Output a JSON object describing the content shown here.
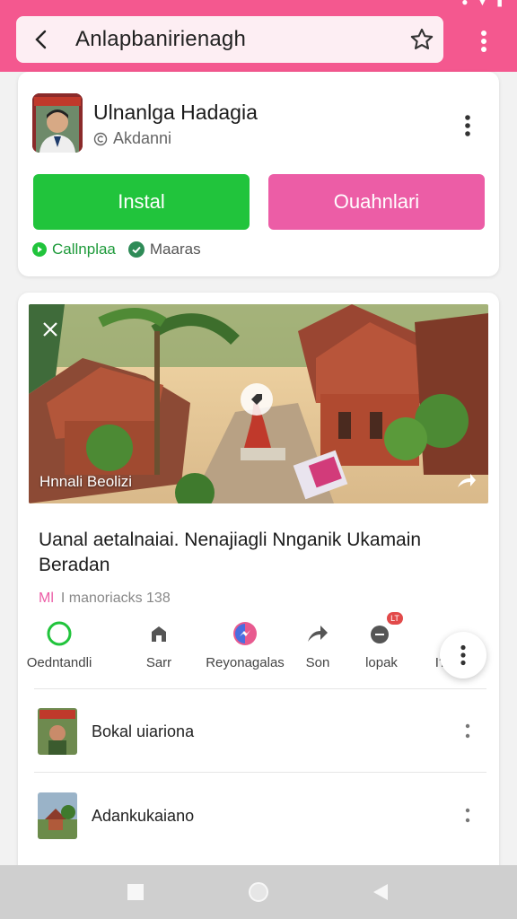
{
  "app_bar": {
    "title": "Anlapbanirienagh",
    "bg_color": "#f4588f"
  },
  "app_card": {
    "name": "Ulnanlga Hadagia",
    "developer": "Akdanni",
    "install_label": "Instal",
    "secondary_label": "Ouahnlari",
    "tags": [
      "Callnplaa",
      "Maaras"
    ],
    "install_color": "#21c43c",
    "secondary_color": "#ec5da6"
  },
  "post": {
    "hero_caption": "Hnnali Beolizi",
    "title": "Uanal aetalnaiai. Nenajiagli Nnganik Ukamain Beradan",
    "meta_accent": "Ml",
    "meta_text": "I manoriacks 138",
    "actions": [
      {
        "label": "Oedntandli",
        "icon": "chat-bubble-icon"
      },
      {
        "label": "Sarr",
        "icon": "home-icon"
      },
      {
        "label": "Reyonagalas",
        "icon": "messenger-icon"
      },
      {
        "label": "Son",
        "icon": "share-arrow-icon"
      },
      {
        "label": "lopak",
        "icon": "notification-icon",
        "badge": "LT"
      },
      {
        "label": "I?",
        "icon": "more-icon"
      }
    ]
  },
  "list": [
    {
      "label": "Bokal uiariona"
    },
    {
      "label": "Adankukaiano"
    }
  ]
}
